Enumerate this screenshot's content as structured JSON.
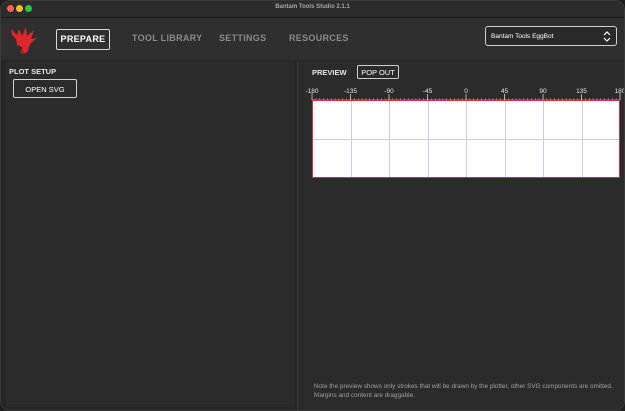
{
  "window": {
    "title": "Bantam Tools Studio 2.1.1"
  },
  "nav": {
    "prepare": "PREPARE",
    "tool_library": "TOOL LIBRARY",
    "settings": "SETTINGS",
    "resources": "RESOURCES"
  },
  "machine_select": {
    "value": "Bantam Tools EggBot"
  },
  "left": {
    "plot_setup_label": "PLOT SETUP",
    "open_svg_label": "OPEN SVG"
  },
  "right": {
    "preview_label": "PREVIEW",
    "popout_label": "POP OUT",
    "ruler_ticks": [
      "-180",
      "-135",
      "-90",
      "-45",
      "0",
      "45",
      "90",
      "135",
      "180"
    ],
    "note": "Note the preview shows only strokes that will be drawn by the plotter, other SVG components are omitted. Margins and content are draggable."
  },
  "colors": {
    "accent_red": "#d2304d",
    "logo_red": "#e0262d"
  },
  "icons": {
    "logo": "phoenix-logo-icon",
    "select": "chevron-up-down-icon"
  }
}
